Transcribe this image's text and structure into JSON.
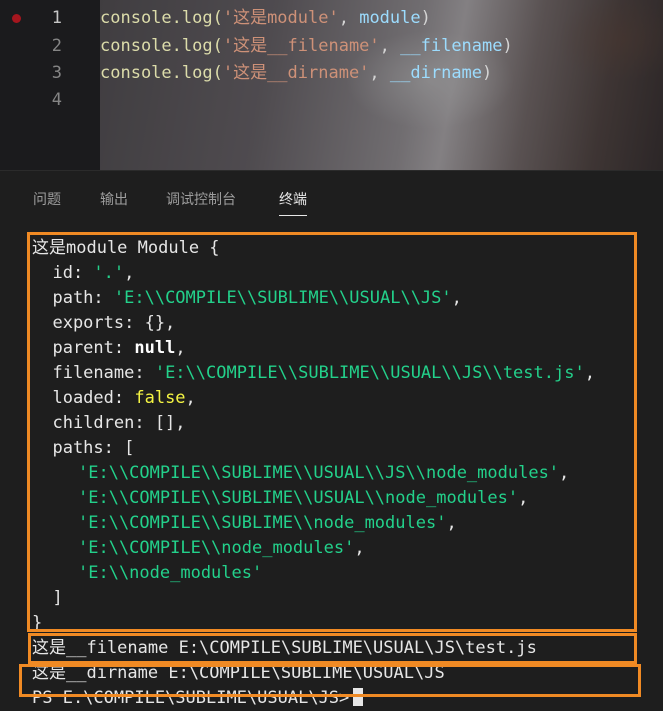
{
  "editor": {
    "lines": [
      {
        "num": "1",
        "fn": "console.log(",
        "str": "'这是module'",
        "sep": ", ",
        "var": "module",
        "end": ")"
      },
      {
        "num": "2",
        "fn": "console.log(",
        "str": "'这是__filename'",
        "sep": ", ",
        "var": "__filename",
        "end": ")"
      },
      {
        "num": "3",
        "fn": "console.log(",
        "str": "'这是__dirname'",
        "sep": ", ",
        "var": "__dirname",
        "end": ")"
      },
      {
        "num": "4"
      }
    ]
  },
  "panel": {
    "tabs": [
      "问题",
      "输出",
      "调试控制台",
      "终端"
    ],
    "active_tab": "终端"
  },
  "terminal": {
    "module_header": "这是module Module {",
    "id_key": "  id: ",
    "id_val": "'.'",
    "path_key": "  path: ",
    "path_val": "'E:\\\\COMPILE\\\\SUBLIME\\\\USUAL\\\\JS'",
    "exports": "  exports: {},",
    "parent_key": "  parent: ",
    "parent_val": "null",
    "filename_key": "  filename: ",
    "filename_val": "'E:\\\\COMPILE\\\\SUBLIME\\\\USUAL\\\\JS\\\\test.js'",
    "loaded_key": "  loaded: ",
    "loaded_val": "false",
    "children": "  children: [],",
    "paths_open": "  paths: [",
    "paths": [
      "'E:\\\\COMPILE\\\\SUBLIME\\\\USUAL\\\\JS\\\\node_modules'",
      "'E:\\\\COMPILE\\\\SUBLIME\\\\USUAL\\\\node_modules'",
      "'E:\\\\COMPILE\\\\SUBLIME\\\\node_modules'",
      "'E:\\\\COMPILE\\\\node_modules'",
      "'E:\\\\node_modules'"
    ],
    "paths_close": "  ]",
    "module_close": "}",
    "filename_line": "这是__filename E:\\COMPILE\\SUBLIME\\USUAL\\JS\\test.js",
    "dirname_line": "这是__dirname E:\\COMPILE\\SUBLIME\\USUAL\\JS",
    "prompt": "PS E:\\COMPILE\\SUBLIME\\USUAL\\JS>"
  },
  "colors": {
    "highlight": "#f08a24",
    "string": "#23d18b",
    "breakpoint": "#a5161e"
  }
}
